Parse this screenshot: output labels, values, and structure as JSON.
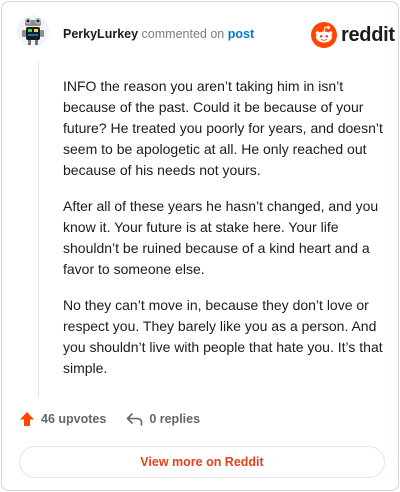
{
  "header": {
    "username": "PerkyLurkey",
    "action_text": "commented on",
    "post_link": "post",
    "logo_text": "reddit"
  },
  "comment": {
    "paragraphs": [
      "INFO the reason you aren’t taking him in isn’t because of the past. Could it be because of your future? He treated you poorly for years, and doesn’t seem to be apologetic at all. He only reached out because of his needs not yours.",
      "After all of these years he hasn’t changed, and you know it. Your future is at stake here. Your life shouldn’t be ruined because of a kind heart and a favor to someone else.",
      "No they can’t move in, because they don’t love or respect you. They barely like you as a person. And you shouldn’t live with people that hate you. It’s that simple."
    ]
  },
  "footer": {
    "upvotes_label": "46 upvotes",
    "replies_label": "0 replies",
    "view_more_label": "View more on Reddit"
  },
  "colors": {
    "reddit_orange": "#ff4500",
    "upvote_orange": "#ff4500",
    "link_blue": "#0079d3",
    "view_more_text": "#e0431c"
  },
  "icons": {
    "avatar": "user-avatar-robot",
    "logo": "reddit-snoo-icon",
    "upvote": "upvote-arrow-icon",
    "reply": "reply-arrow-icon"
  }
}
